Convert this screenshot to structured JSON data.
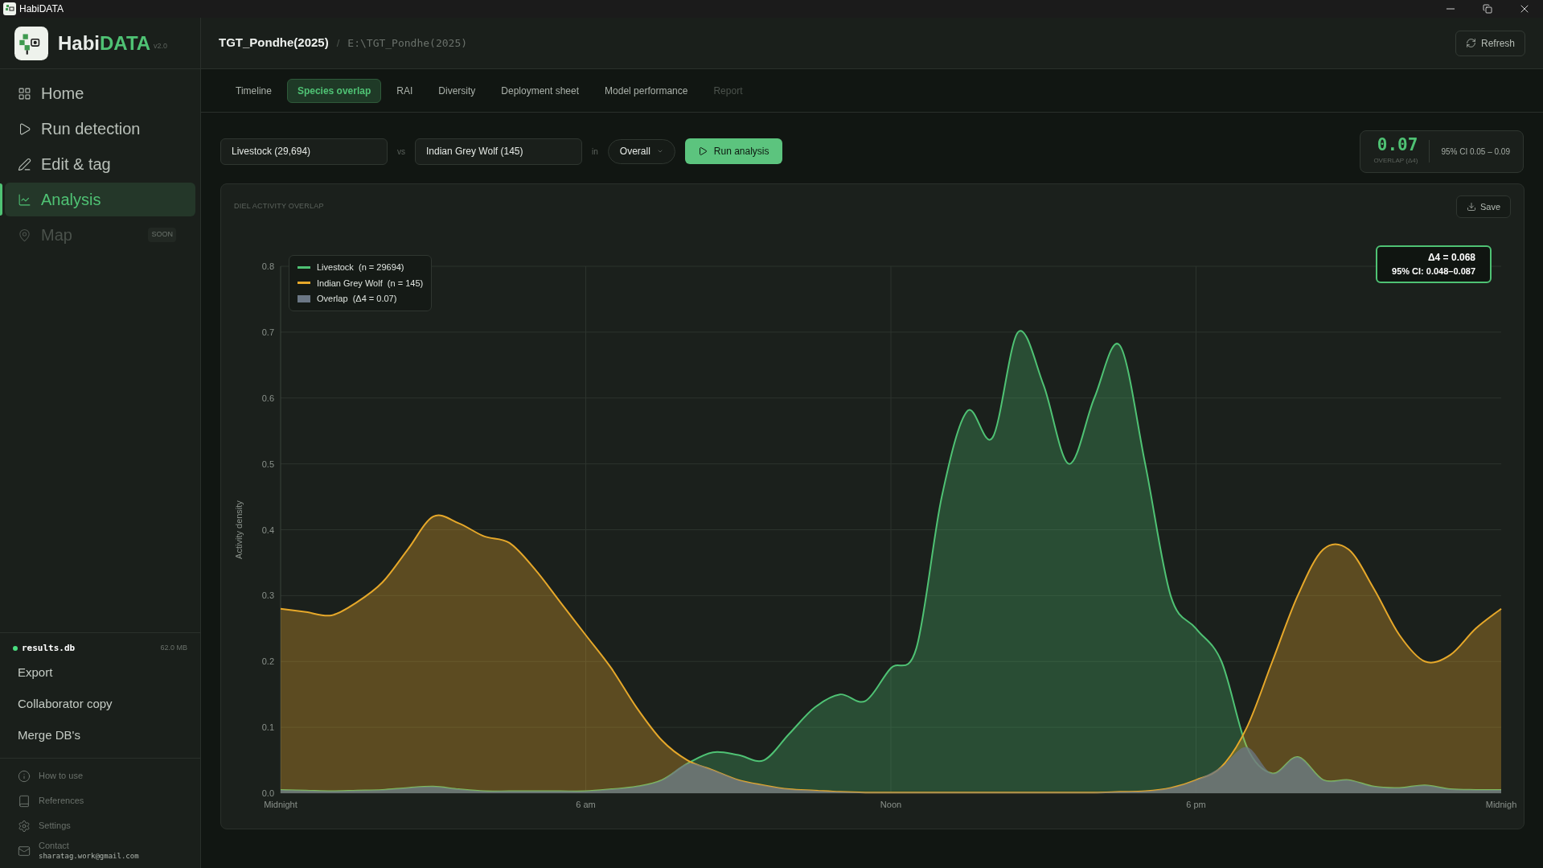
{
  "window": {
    "title": "HabiDATA"
  },
  "brand": {
    "name_start": "Habi",
    "name_end": "DATA",
    "version": "v2.0"
  },
  "nav": [
    {
      "label": "Home",
      "selected": false,
      "disabled": false
    },
    {
      "label": "Run detection",
      "selected": false,
      "disabled": false
    },
    {
      "label": "Edit & tag",
      "selected": false,
      "disabled": false
    },
    {
      "label": "Analysis",
      "selected": true,
      "disabled": false
    },
    {
      "label": "Map",
      "selected": false,
      "disabled": true,
      "badge": "SOON"
    }
  ],
  "database": {
    "name": "results.db",
    "size": "62.0 MB",
    "color": "#4ade80"
  },
  "db_actions": [
    "Export",
    "Collaborator copy",
    "Merge DB's"
  ],
  "footer_links": [
    {
      "label": "How to use"
    },
    {
      "label": "References"
    },
    {
      "label": "Settings"
    },
    {
      "label": "Contact",
      "detail": "sharatag.work@gmail.com"
    }
  ],
  "project": {
    "name": "TGT_Pondhe(2025)",
    "separator": "/",
    "path": "E:\\TGT_Pondhe(2025)"
  },
  "refresh_button": "Refresh",
  "tabs": [
    {
      "label": "Timeline",
      "selected": false,
      "disabled": false
    },
    {
      "label": "Species overlap",
      "selected": true,
      "disabled": false
    },
    {
      "label": "RAI",
      "selected": false,
      "disabled": false
    },
    {
      "label": "Diversity",
      "selected": false,
      "disabled": false
    },
    {
      "label": "Deployment sheet",
      "selected": false,
      "disabled": false
    },
    {
      "label": "Model performance",
      "selected": false,
      "disabled": false
    },
    {
      "label": "Report",
      "selected": false,
      "disabled": true
    }
  ],
  "controls": {
    "species_a": "Livestock (29,694)",
    "vs": "vs",
    "species_b": "Indian Grey Wolf (145)",
    "in": "in",
    "period": "Overall",
    "run_button": "Run analysis"
  },
  "overlap_stat": {
    "value": "0.07",
    "label": "OVERLAP (Δ4)",
    "ci": "95% CI 0.05 – 0.09"
  },
  "chart_card": {
    "title": "DIEL ACTIVITY OVERLAP",
    "save_button": "Save",
    "overlap_legend": {
      "label": "Overlap  (Δ4 = 0.07)",
      "color": "#6b7785"
    },
    "estimate": {
      "line_1": "Δ4 = 0.068",
      "line_2": "95% CI: 0.048–0.087"
    },
    "chart_data": {
      "type": "area",
      "grid": true,
      "ylabel": "Activity density",
      "categories": [
        "Midnight",
        null,
        null,
        null,
        null,
        null,
        null,
        null,
        null,
        null,
        null,
        null,
        "6 am",
        null,
        null,
        null,
        null,
        null,
        null,
        null,
        null,
        null,
        null,
        null,
        "Noon",
        null,
        null,
        null,
        null,
        null,
        null,
        null,
        null,
        null,
        null,
        null,
        "6 pm",
        null,
        null,
        null,
        null,
        null,
        null,
        null,
        null,
        null,
        null,
        null,
        "Midnigh"
      ],
      "series": [
        {
          "name": "Livestock  (n = 29694)",
          "color": "#4fc274",
          "values": [
            0.005,
            0.004,
            0.003,
            0.004,
            0.005,
            0.008,
            0.01,
            0.006,
            0.003,
            0.003,
            0.003,
            0.003,
            0.003,
            0.006,
            0.01,
            0.02,
            0.045,
            0.062,
            0.058,
            0.05,
            0.09,
            0.13,
            0.15,
            0.14,
            0.19,
            0.22,
            0.45,
            0.58,
            0.54,
            0.7,
            0.62,
            0.5,
            0.6,
            0.68,
            0.5,
            0.3,
            0.25,
            0.2,
            0.07,
            0.03,
            0.055,
            0.02,
            0.02,
            0.01,
            0.008,
            0.012,
            0.006,
            0.005,
            0.005
          ]
        },
        {
          "name": "Indian Grey Wolf  (n = 145)",
          "color": "#e6a82a",
          "values": [
            0.28,
            0.275,
            0.27,
            0.29,
            0.32,
            0.37,
            0.42,
            0.41,
            0.39,
            0.38,
            0.34,
            0.29,
            0.24,
            0.19,
            0.13,
            0.08,
            0.05,
            0.035,
            0.02,
            0.012,
            0.006,
            0.004,
            0.002,
            0.001,
            0.001,
            0.001,
            0.001,
            0.001,
            0.001,
            0.001,
            0.001,
            0.001,
            0.001,
            0.002,
            0.003,
            0.008,
            0.02,
            0.04,
            0.1,
            0.2,
            0.3,
            0.37,
            0.37,
            0.31,
            0.24,
            0.2,
            0.21,
            0.25,
            0.28
          ]
        }
      ],
      "ylim": [
        0,
        0.8
      ],
      "yticks": [
        {
          "value": 0,
          "label": "0.0"
        },
        {
          "value": 0.1,
          "label": "0.1"
        },
        {
          "value": 0.2,
          "label": "0.2"
        },
        {
          "value": 0.3,
          "label": "0.3"
        },
        {
          "value": 0.4,
          "label": "0.4"
        },
        {
          "value": 0.5,
          "label": "0.5"
        },
        {
          "value": 0.6,
          "label": "0.6"
        },
        {
          "value": 0.7,
          "label": "0.7"
        },
        {
          "value": 0.8,
          "label": "0.8"
        }
      ]
    }
  }
}
